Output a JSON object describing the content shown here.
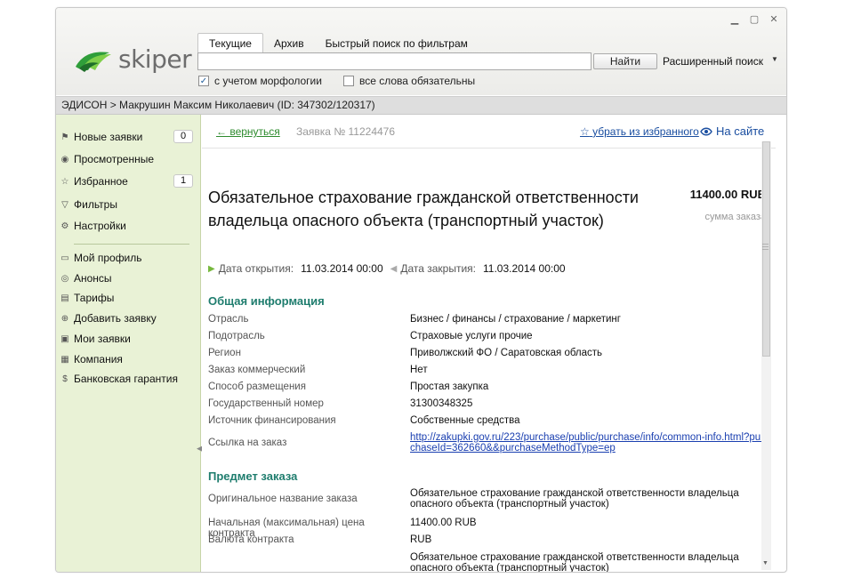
{
  "window": {
    "controls": [
      "minimize-icon",
      "maximize-icon",
      "close-icon"
    ]
  },
  "logo": {
    "text": "skiper"
  },
  "tabs": [
    {
      "label": "Текущие",
      "active": true
    },
    {
      "label": "Архив",
      "active": false
    },
    {
      "label": "Быстрый поиск по фильтрам",
      "active": false
    }
  ],
  "search": {
    "value": "",
    "find_label": "Найти",
    "advanced_label": "Расширенный поиск"
  },
  "options": {
    "morphology": {
      "label": "с учетом морфологии",
      "checked": true
    },
    "all_words": {
      "label": "все слова обязательны",
      "checked": false
    }
  },
  "breadcrumb": "ЭДИСОН > Макрушин Максим Николаевич (ID: 347302/120317)",
  "sidebar": {
    "items": [
      {
        "label": "Новые заявки",
        "icon": "flag-icon",
        "badge": "0"
      },
      {
        "label": "Просмотренные",
        "icon": "eye-icon"
      },
      {
        "label": "Избранное",
        "icon": "star-icon",
        "badge": "1"
      },
      {
        "label": "Фильтры",
        "icon": "filter-icon"
      },
      {
        "label": "Настройки",
        "icon": "gear-icon"
      },
      {
        "label": "Мой профиль",
        "icon": "briefcase-icon"
      },
      {
        "label": "Анонсы",
        "icon": "announce-icon"
      },
      {
        "label": "Тарифы",
        "icon": "document-icon"
      },
      {
        "label": "Добавить заявку",
        "icon": "add-document-icon"
      },
      {
        "label": "Мои заявки",
        "icon": "folder-icon"
      },
      {
        "label": "Компания",
        "icon": "company-icon"
      },
      {
        "label": "Банковская гарантия",
        "icon": "dollar-icon"
      }
    ]
  },
  "request": {
    "back_label": "← вернуться",
    "number": "Заявка № 11224476",
    "unfavorite_label": "убрать из избранного",
    "on_site_label": "На сайте",
    "title": "Обязательное страхование гражданской ответственности владельца опасного объекта (транспортный участок)",
    "price": "11400.00 RUB",
    "price_label": "сумма заказа",
    "open_label": "Дата открытия:",
    "open_date": "11.03.2014 00:00",
    "close_label": "Дата закрытия:",
    "close_date": "11.03.2014 00:00"
  },
  "general": {
    "heading": "Общая информация",
    "rows": [
      {
        "label": "Отрасль",
        "value": "Бизнес / финансы / страхование / маркетинг"
      },
      {
        "label": "Подотрасль",
        "value": "Страховые услуги прочие"
      },
      {
        "label": "Регион",
        "value": "Приволжский ФО / Саратовская область"
      },
      {
        "label": "Заказ коммерческий",
        "value": "Нет"
      },
      {
        "label": "Способ размещения",
        "value": "Простая закупка"
      },
      {
        "label": "Государственный номер",
        "value": "31300348325"
      },
      {
        "label": "Источник финансирования",
        "value": "Собственные средства"
      },
      {
        "label": "Ссылка на заказ",
        "value": "http://zakupki.gov.ru/223/purchase/public/purchase/info/common-info.html?purchaseId=362660&&purchaseMethodType=ep"
      }
    ]
  },
  "subject": {
    "heading": "Предмет заказа",
    "rows": [
      {
        "label": "Оригинальное название заказа",
        "value": "Обязательное страхование гражданской ответственности владельца опасного объекта (транспортный участок)"
      },
      {
        "label": "Начальная (максимальная) цена контракта",
        "value": "11400.00 RUB"
      },
      {
        "label": "Валюта контракта",
        "value": "RUB"
      },
      {
        "label": "",
        "value": "Обязательное страхование гражданской ответственности владельца опасного объекта (транспортный участок)"
      }
    ]
  },
  "colors": {
    "sidebar_bg": "#e9f2d6",
    "section_heading": "#1f7d6e",
    "link": "#1a4ea0",
    "back_link": "#2e8b2e"
  }
}
